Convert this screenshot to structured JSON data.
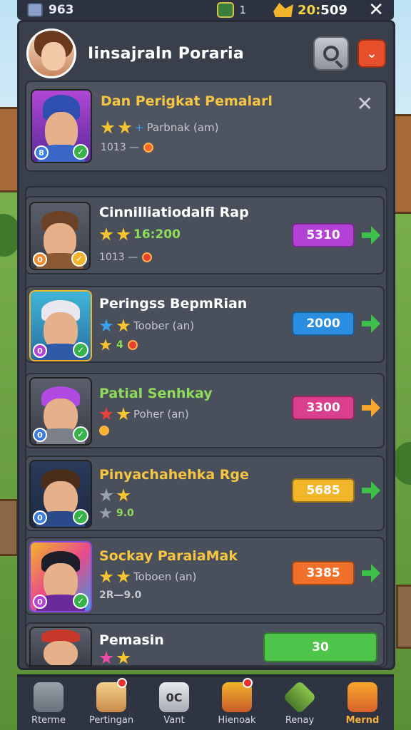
{
  "topbar": {
    "currency_value": "963",
    "level_value": "1",
    "timer_gold": "20:",
    "timer_white": "509",
    "close_glyph": "✕"
  },
  "header": {
    "title": "Iinsajraln Poraria"
  },
  "featured": {
    "name": "Dan Perigkat Pemalarl",
    "subtitle": "Parbnak (am)",
    "info": "1013 —",
    "close_glyph": "✕",
    "badge_left": "8",
    "badge_right": "✓"
  },
  "players": [
    {
      "name": "Cinnilliatiodalfi Rap",
      "stat": "16:200",
      "info": "1013 —",
      "value": "5310",
      "pill_color": "#b441d6",
      "arrow": "green",
      "badge_left": "0",
      "badge_right": "✓"
    },
    {
      "name": "Peringss BepmRian",
      "stat": "Toober (an)",
      "info": "4",
      "value": "2000",
      "pill_color": "#2a8fe0",
      "arrow": "green",
      "badge_left": "0",
      "badge_right": "✓"
    },
    {
      "name": "Patial Senhkay",
      "stat": "Poher (an)",
      "info": "",
      "value": "3300",
      "pill_color": "#d93f8c",
      "arrow": "orange",
      "badge_left": "0",
      "badge_right": "✓"
    },
    {
      "name": "Pinyachahehka Rge",
      "stat": "",
      "info": "9.0",
      "value": "5685",
      "pill_color": "#f2b62a",
      "arrow": "green",
      "badge_left": "0",
      "badge_right": "✓"
    },
    {
      "name": "Sockay ParaiaMak",
      "stat": "Toboen (an)",
      "info": "2R—9.0",
      "value": "3385",
      "pill_color": "#f0702a",
      "arrow": "green",
      "badge_left": "0",
      "badge_right": "✓"
    },
    {
      "name": "Pemasin",
      "stat": "",
      "info": "",
      "value": "30",
      "pill_color": "#4fc44a",
      "arrow": "",
      "badge_left": "",
      "badge_right": ""
    }
  ],
  "nav": [
    {
      "label": "Rterme",
      "icon": "castle-icon"
    },
    {
      "label": "Pertingan",
      "icon": "hero-icon"
    },
    {
      "label": "Vant",
      "icon": "chat-icon",
      "glyph": "0C"
    },
    {
      "label": "Hienoak",
      "icon": "treasure-icon"
    },
    {
      "label": "Renay",
      "icon": "shield-icon"
    },
    {
      "label": "Mernd",
      "icon": "chest-icon"
    }
  ]
}
